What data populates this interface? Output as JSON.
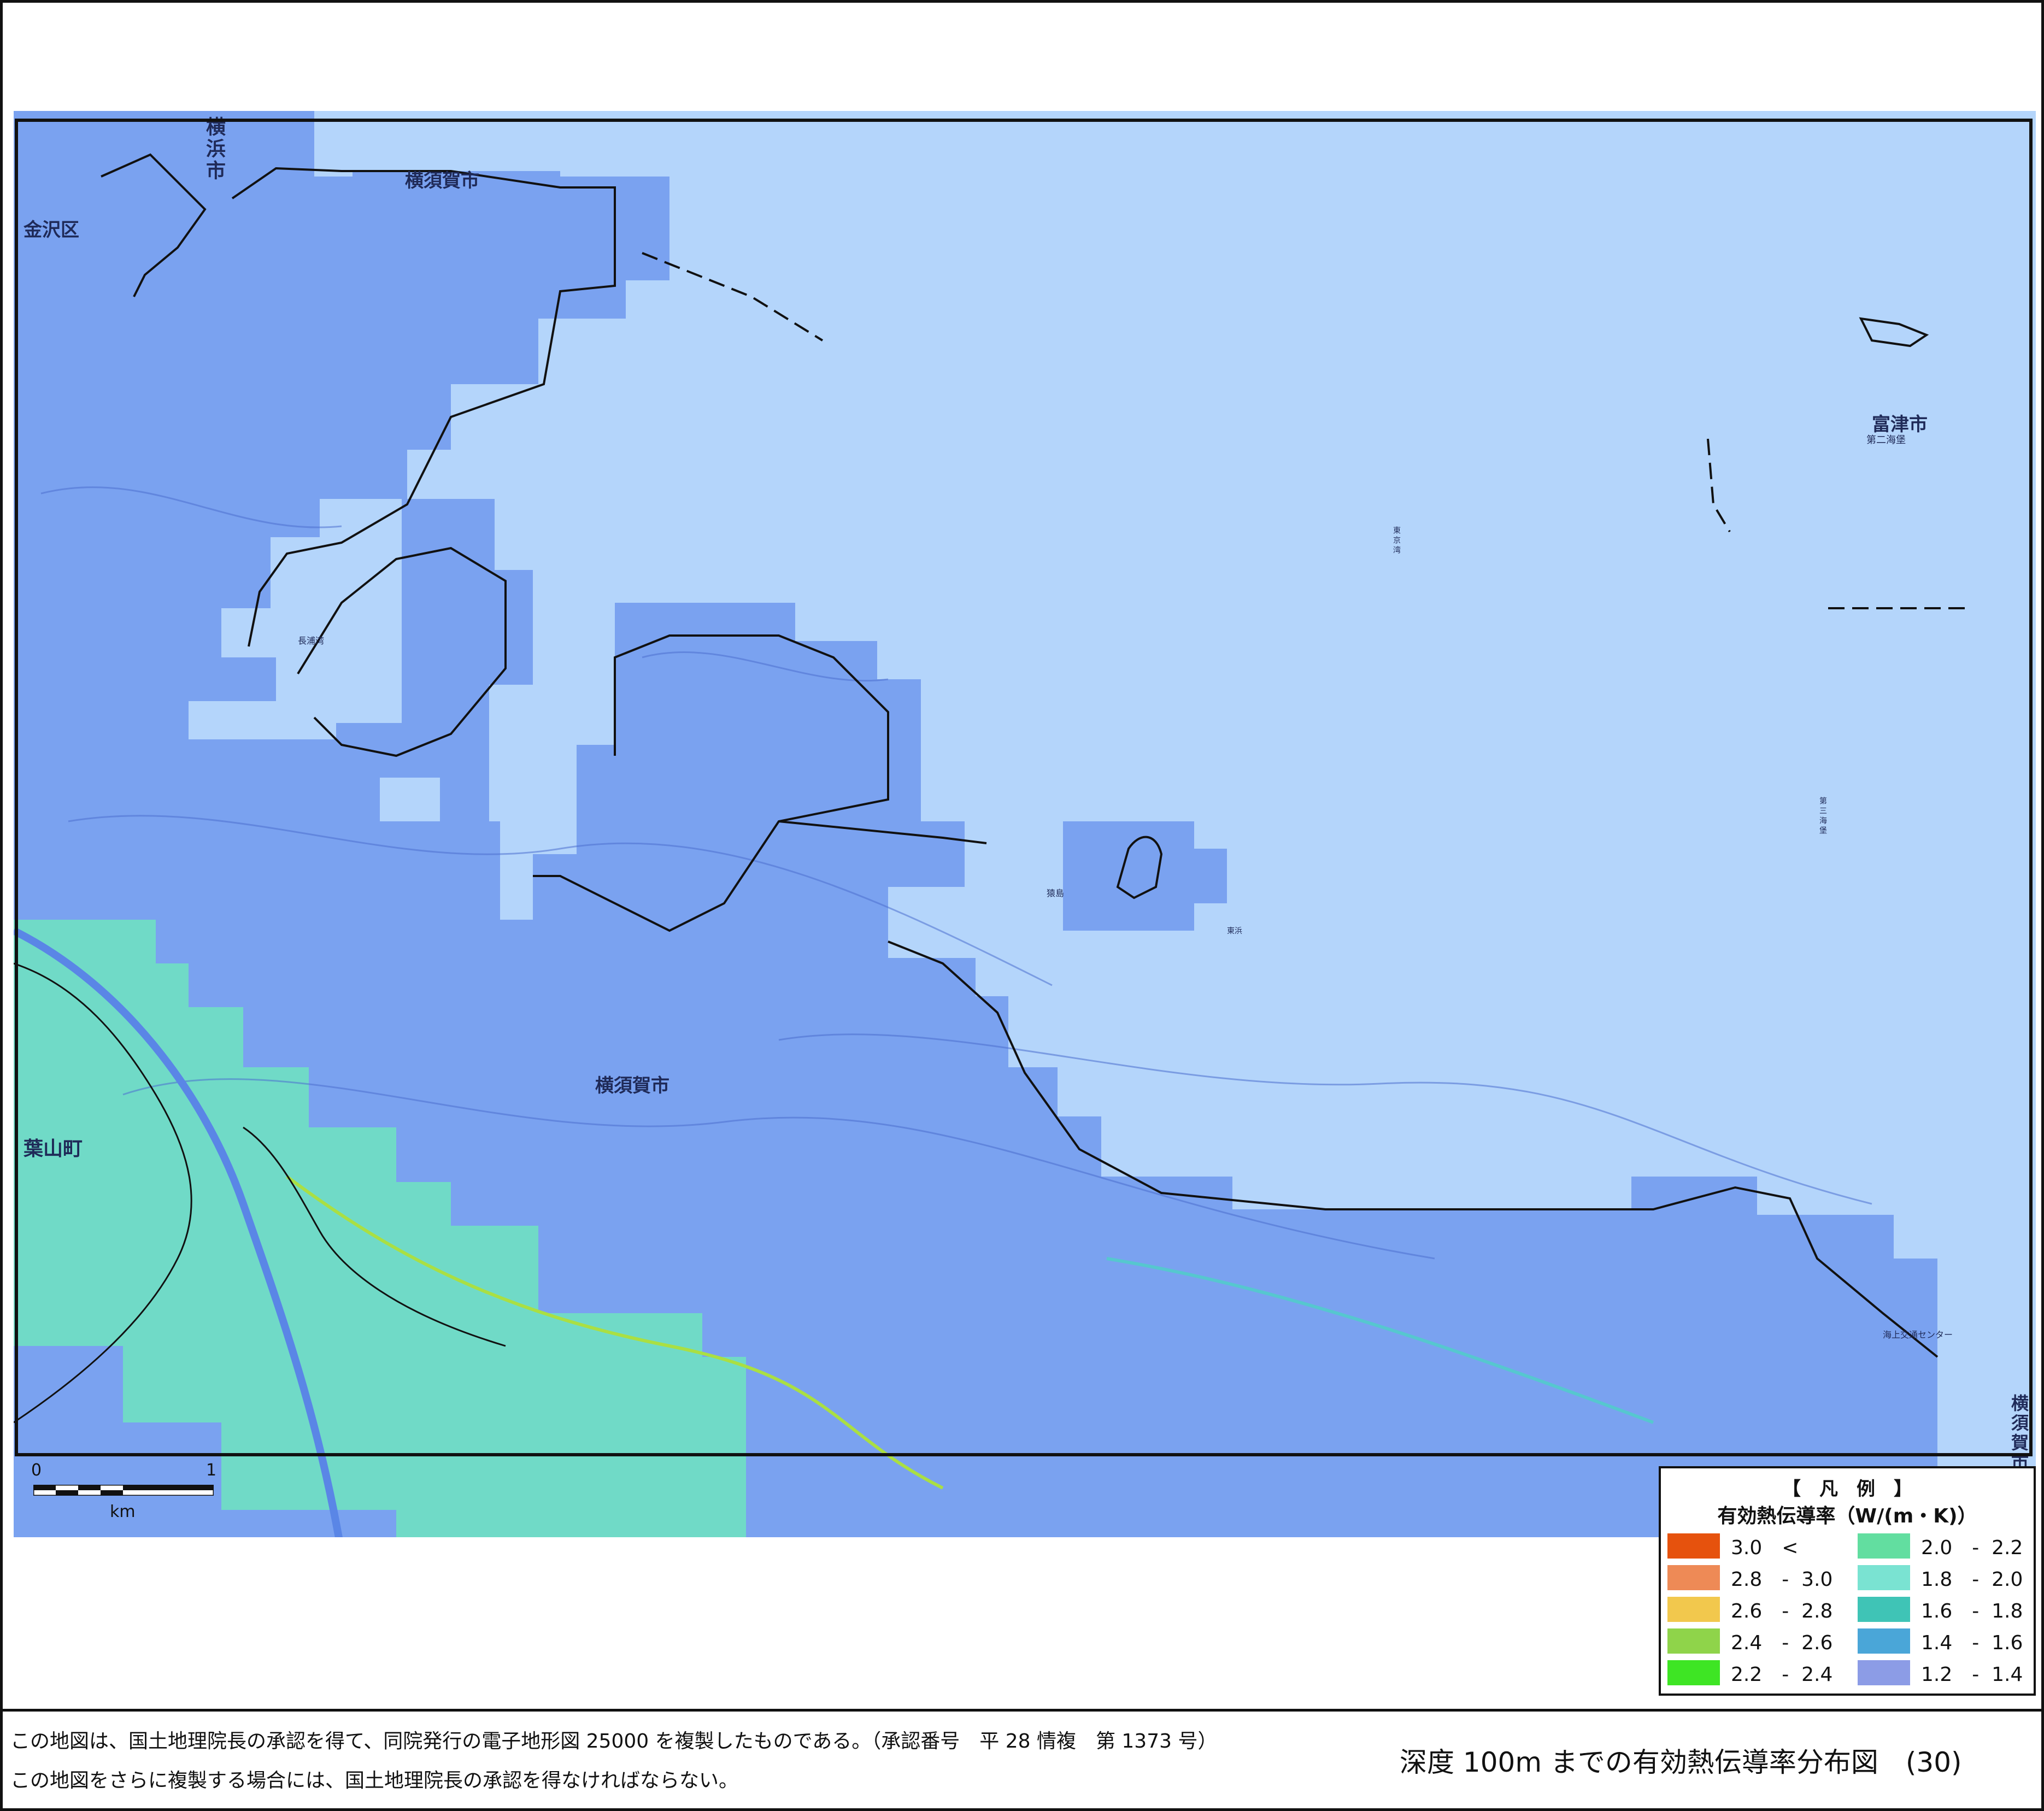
{
  "map": {
    "place_labels": {
      "yokohama_city": "横浜市",
      "yokosuka_city_north": "横須賀市",
      "kanazawa_ward": "金沢区",
      "futtsu_city": "富津市",
      "yokosuka_city_center": "横須賀市",
      "hayama_town": "葉山町",
      "yokosuka_city_edge": "横須賀市",
      "dai2_kaiho": "第二海堡",
      "dai3_kaiho": "第三海堡",
      "sarushima": "猿島",
      "tokyo_bay": "東京湾",
      "nagaura": "長浦湾",
      "sea_center": "海上交通センター",
      "higashi_hama": "東浜"
    },
    "colors": {
      "sea": "#b4d5fb",
      "land_blue": "#7aa2f0",
      "land_green": "#6fe0c2",
      "coastline": "#111111",
      "legend_highlight": "#7ae3d2"
    }
  },
  "scale_bar": {
    "zero": "0",
    "one": "1",
    "unit": "km"
  },
  "legend": {
    "title": "【　凡　例　】",
    "subtitle": "有効熱伝導率（W/(m・K)）",
    "items": [
      {
        "label": "3.0　<",
        "color": "#e6520d"
      },
      {
        "label": "2.8　-  3.0",
        "color": "#ee8a56"
      },
      {
        "label": "2.6　-  2.8",
        "color": "#f2c84d"
      },
      {
        "label": "2.4　-  2.6",
        "color": "#8fd44a"
      },
      {
        "label": "2.2　-  2.4",
        "color": "#3ee524"
      },
      {
        "label": "2.0　-  2.2",
        "color": "#62dea0"
      },
      {
        "label": "1.8　-  2.0",
        "color": "#7ae3d2"
      },
      {
        "label": "1.6　-  1.8",
        "color": "#3fc4b6"
      },
      {
        "label": "1.4　-  1.6",
        "color": "#4aa6d8"
      },
      {
        "label": "1.2　-  1.4",
        "color": "#8c9ce6"
      }
    ]
  },
  "footer": {
    "credit_line_1": "この地図は、国土地理院長の承認を得て、同院発行の電子地形図 25000 を複製したものである。（承認番号　平 28 情複　第 1373 号）",
    "credit_line_2": "この地図をさらに複製する場合には、国土地理院長の承認を得なければならない。",
    "map_title": "深度 100m までの有効熱伝導率分布図　(30)"
  }
}
